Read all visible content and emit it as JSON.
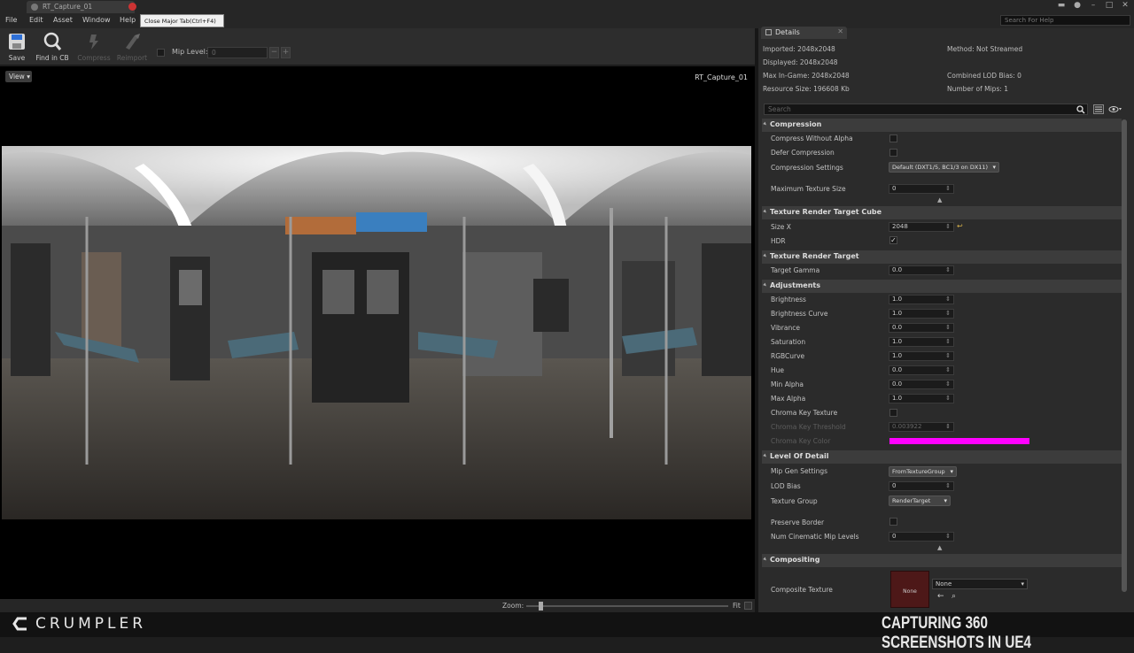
{
  "window": {
    "tab_title": "RT_Capture_01",
    "tooltip": "Close Major Tab(Ctrl+F4)",
    "help_search_placeholder": "Search For Help"
  },
  "menu": {
    "items": [
      "File",
      "Edit",
      "Asset",
      "Window",
      "Help"
    ]
  },
  "toolbar": {
    "buttons": [
      {
        "label": "Save",
        "icon": "save-icon",
        "enabled": true
      },
      {
        "label": "Find in CB",
        "icon": "find-icon",
        "enabled": true
      },
      {
        "label": "Compress",
        "icon": "compress-icon",
        "enabled": false
      },
      {
        "label": "Reimport",
        "icon": "reimport-icon",
        "enabled": false
      }
    ],
    "mip_level_label": "Mip Level:",
    "mip_level_value": "0"
  },
  "viewport": {
    "view_button": "View",
    "texture_name": "RT_Capture_01",
    "zoom_label": "Zoom:",
    "zoom_fit": "Fit"
  },
  "details": {
    "tab_label": "Details",
    "info": {
      "imported": "Imported: 2048x2048",
      "displayed": "Displayed: 2048x2048",
      "max_in_game": "Max In-Game: 2048x2048",
      "resource_size": "Resource Size: 196608 Kb",
      "method": "Method: Not Streamed",
      "combined_lod_bias": "Combined LOD Bias: 0",
      "number_of_mips": "Number of Mips: 1"
    },
    "search_placeholder": "Search",
    "compression": {
      "header": "Compression",
      "compress_without_alpha": "Compress Without Alpha",
      "defer_compression": "Defer Compression",
      "compression_settings_label": "Compression Settings",
      "compression_settings_value": "Default (DXT1/5, BC1/3 on DX11)",
      "max_texture_size_label": "Maximum Texture Size",
      "max_texture_size_value": "0"
    },
    "render_target_cube": {
      "header": "Texture Render Target Cube",
      "size_x_label": "Size X",
      "size_x_value": "2048",
      "hdr_label": "HDR"
    },
    "render_target": {
      "header": "Texture Render Target",
      "target_gamma_label": "Target Gamma",
      "target_gamma_value": "0.0"
    },
    "adjustments": {
      "header": "Adjustments",
      "brightness_label": "Brightness",
      "brightness_value": "1.0",
      "brightness_curve_label": "Brightness Curve",
      "brightness_curve_value": "1.0",
      "vibrance_label": "Vibrance",
      "vibrance_value": "0.0",
      "saturation_label": "Saturation",
      "saturation_value": "1.0",
      "rgbcurve_label": "RGBCurve",
      "rgbcurve_value": "1.0",
      "hue_label": "Hue",
      "hue_value": "0.0",
      "min_alpha_label": "Min Alpha",
      "min_alpha_value": "0.0",
      "max_alpha_label": "Max Alpha",
      "max_alpha_value": "1.0",
      "chroma_key_texture_label": "Chroma Key Texture",
      "chroma_key_threshold_label": "Chroma Key Threshold",
      "chroma_key_threshold_value": "0.003922",
      "chroma_key_color_label": "Chroma Key Color",
      "chroma_key_color": "#ff00ff"
    },
    "lod": {
      "header": "Level Of Detail",
      "mip_gen_label": "Mip Gen Settings",
      "mip_gen_value": "FromTextureGroup",
      "lod_bias_label": "LOD Bias",
      "lod_bias_value": "0",
      "texture_group_label": "Texture Group",
      "texture_group_value": "RenderTarget",
      "preserve_border_label": "Preserve Border",
      "num_cinematic_label": "Num Cinematic Mip Levels",
      "num_cinematic_value": "0"
    },
    "compositing": {
      "header": "Compositing",
      "composite_texture_label": "Composite Texture",
      "thumbnail_text": "None",
      "combo_value": "None"
    }
  },
  "footer": {
    "brand": "CRUMPLER",
    "caption": "CAPTURING 360 SCREENSHOTS IN UE4"
  }
}
